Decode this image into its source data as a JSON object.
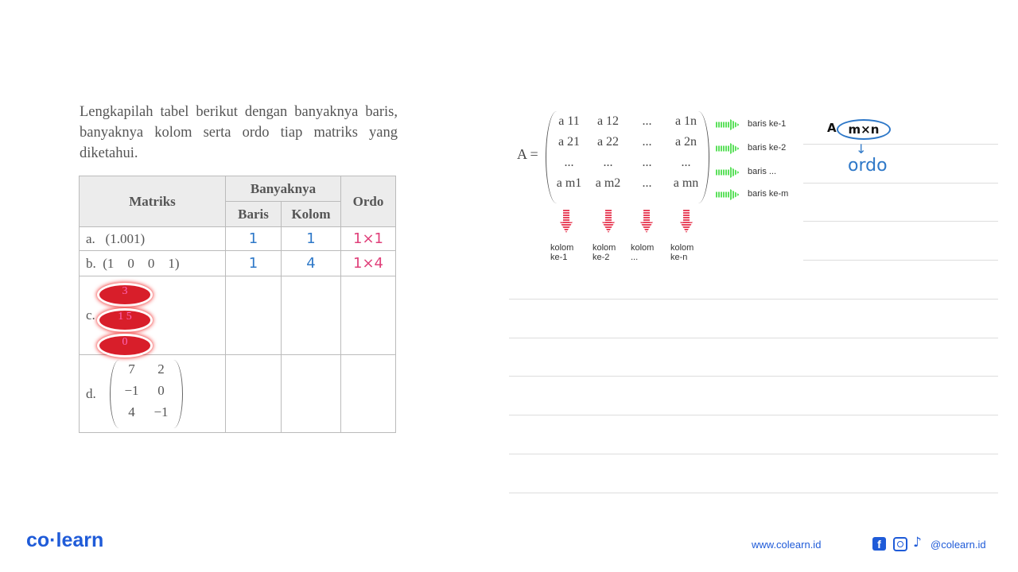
{
  "question": "Lengkapilah tabel berikut dengan banyaknya baris, banyaknya kolom serta ordo tiap matriks yang diketahui.",
  "table": {
    "headers": {
      "matriks": "Matriks",
      "banyaknya": "Banyaknya",
      "baris": "Baris",
      "kolom": "Kolom",
      "ordo": "Ordo"
    },
    "rows": [
      {
        "label": "a.",
        "matrix": "(1.001)",
        "baris": "1",
        "kolom": "1",
        "ordo": "1×1"
      },
      {
        "label": "b.",
        "matrix": "(1    0    0    1)",
        "baris": "1",
        "kolom": "4",
        "ordo": "1×4"
      },
      {
        "label": "c.",
        "matrix": [
          "3",
          "1  5",
          "0"
        ],
        "baris": "",
        "kolom": "",
        "ordo": ""
      },
      {
        "label": "d.",
        "matrix": [
          [
            "7",
            "2"
          ],
          [
            "−1",
            "0"
          ],
          [
            "4",
            "−1"
          ]
        ],
        "baris": "",
        "kolom": "",
        "ordo": ""
      }
    ]
  },
  "general_matrix": {
    "lhs": "A =",
    "cells": [
      [
        "a 11",
        "a 12",
        "...",
        "a 1n"
      ],
      [
        "a 21",
        "a 22",
        "...",
        "a 2n"
      ],
      [
        "...",
        "...",
        "...",
        "..."
      ],
      [
        "a m1",
        "a m2",
        "...",
        "a mn"
      ]
    ],
    "row_labels": [
      "baris ke-1",
      "baris ke-2",
      "baris ...",
      "baris ke-m"
    ],
    "col_labels": [
      [
        "kolom",
        "ke-1"
      ],
      [
        "kolom",
        "ke-2"
      ],
      [
        "kolom",
        "..."
      ],
      [
        "kolom",
        "ke-n"
      ]
    ]
  },
  "note": {
    "a": "A",
    "order": "m×n",
    "ordo": "ordo"
  },
  "footer": {
    "logo": "co·learn",
    "website": "www.colearn.id",
    "handle": "@colearn.id"
  },
  "colors": {
    "handwriting_blue": "#2e78c8",
    "handwriting_pink": "#e0407a",
    "brand": "#1f5bd8",
    "row_arrow": "#5ce05c",
    "col_arrow": "#e8445c"
  }
}
